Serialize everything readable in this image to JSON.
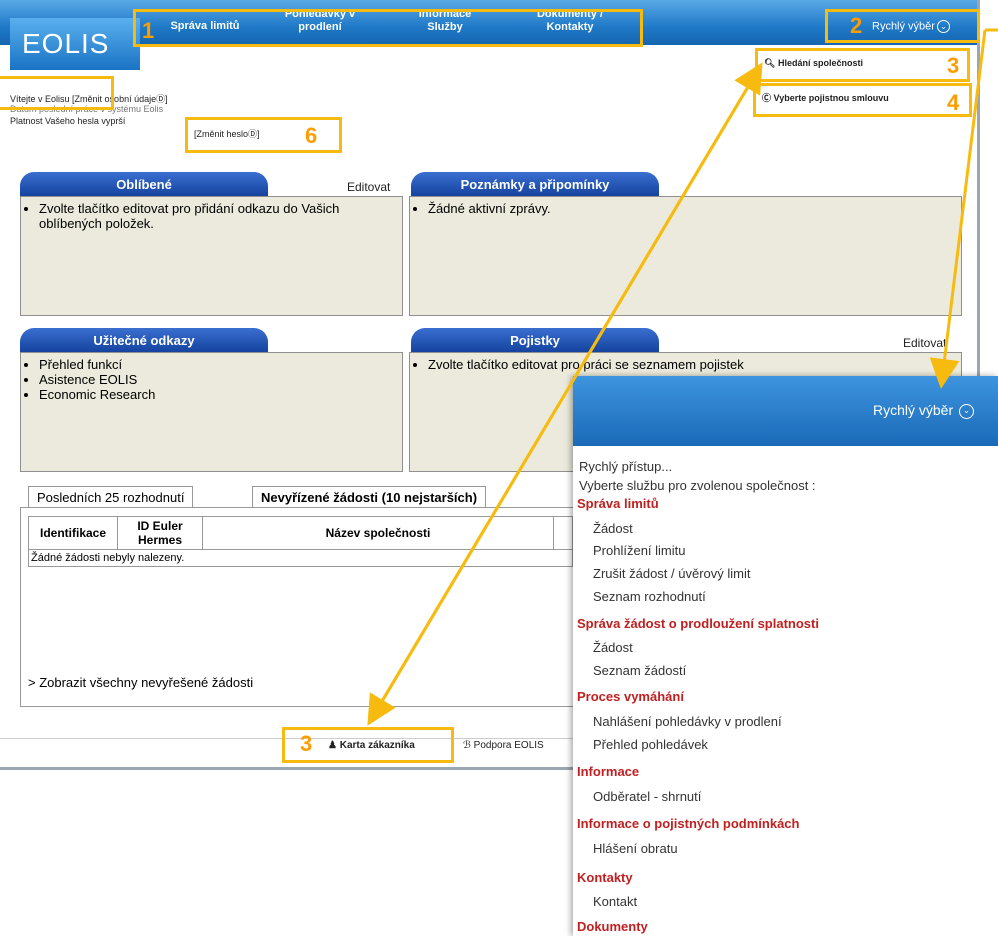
{
  "header": {
    "logo": "EOLIS",
    "nav": [
      {
        "label": "Správa limitů"
      },
      {
        "label": "Pohledávky v prodlení"
      },
      {
        "label": "Informace Služby"
      },
      {
        "label": "Dokumenty / Kontakty"
      }
    ],
    "quick_select": "Rychlý výběr"
  },
  "links": {
    "company_search": "Hledání společnosti",
    "select_policy": "Vyberte pojistnou smlouvu"
  },
  "welcome": {
    "line1": "Vítejte v Eolisu",
    "change_personal": "[Změnit osobní údaje",
    "line2": "Datum poslední práce v systému Eolis",
    "line3": "Platnost Vašeho hesla vyprší",
    "change_password": "[Změnit heslo"
  },
  "panels": {
    "favorites": {
      "title": "Oblíbené",
      "edit": "Editovat",
      "text": "Zvolte tlačítko editovat pro přidání odkazu do Vašich oblíbených položek."
    },
    "notes": {
      "title": "Poznámky a připomínky",
      "text": "Žádné aktivní zprávy."
    },
    "useful": {
      "title": "Užitečné odkazy",
      "items": [
        "Přehled funkcí",
        "Asistence EOLIS",
        "Economic Research"
      ]
    },
    "policies": {
      "title": "Pojistky",
      "edit": "Editovat",
      "text": "Zvolte tlačítko editovat pro práci se seznamem pojistek"
    }
  },
  "tabs": {
    "tab1": "Posledních 25 rozhodnutí",
    "tab2": "Nevyřízené žádosti (10 nejstarších)"
  },
  "table": {
    "headers": [
      "Identifikace",
      "ID Euler Hermes",
      "Název společnosti"
    ],
    "empty": "Žádné žádosti nebyly nalezeny.",
    "show_all": "> Zobrazit všechny nevyřešené žádosti"
  },
  "footer": {
    "customer_card": "Karta zákazníka",
    "support": "Podpora EOLIS"
  },
  "popup": {
    "title": "Rychlý výběr",
    "intro1": "Rychlý přístup...",
    "intro2": "Vyberte službu pro zvolenou společnost :",
    "sections": [
      {
        "title": "Správa limitů",
        "items": [
          "Žádost",
          "Prohlížení limitu",
          "Zrušit žádost / úvěrový limit",
          "Seznam rozhodnutí"
        ]
      },
      {
        "title": "Správa žádost o prodloužení splatnosti",
        "items": [
          "Žádost",
          "Seznam žádostí"
        ]
      },
      {
        "title": "Proces vymáhání",
        "items": [
          "Nahlášení pohledávky v prodlení",
          "Přehled pohledávek"
        ]
      },
      {
        "title": "Informace",
        "items": [
          "Odběratel - shrnutí"
        ]
      },
      {
        "title": "Informace o pojistných podmínkách",
        "items": [
          "Hlášení obratu"
        ]
      },
      {
        "title": "Kontakty",
        "items": [
          "Kontakt"
        ]
      },
      {
        "title": "Dokumenty",
        "items": []
      }
    ]
  },
  "annotations": {
    "n1": "1",
    "n2": "2",
    "n3": "3",
    "n4": "4",
    "n6": "6",
    "n3b": "3"
  },
  "colors": {
    "annotation": "#f7bb10",
    "number": "#ff9d00",
    "header_blue": "#1f79c7",
    "panel_tab": "#123f9b",
    "section_red": "#c02020"
  }
}
